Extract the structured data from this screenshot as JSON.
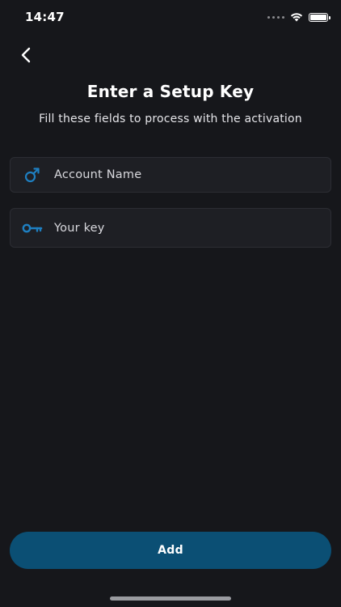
{
  "status_bar": {
    "time": "14:47"
  },
  "header": {
    "back_icon": "chevron-left-icon",
    "title": "Enter a Setup Key",
    "subtitle": "Fill these fields to process with the activation"
  },
  "form": {
    "account": {
      "icon": "male-symbol-icon",
      "placeholder": "Account Name",
      "value": ""
    },
    "key": {
      "icon": "key-icon",
      "placeholder": "Your key",
      "value": ""
    }
  },
  "actions": {
    "add_label": "Add"
  },
  "colors": {
    "background": "#16171b",
    "field_background": "#1e1f24",
    "accent": "#0b4f74",
    "icon": "#1e7fc1"
  }
}
